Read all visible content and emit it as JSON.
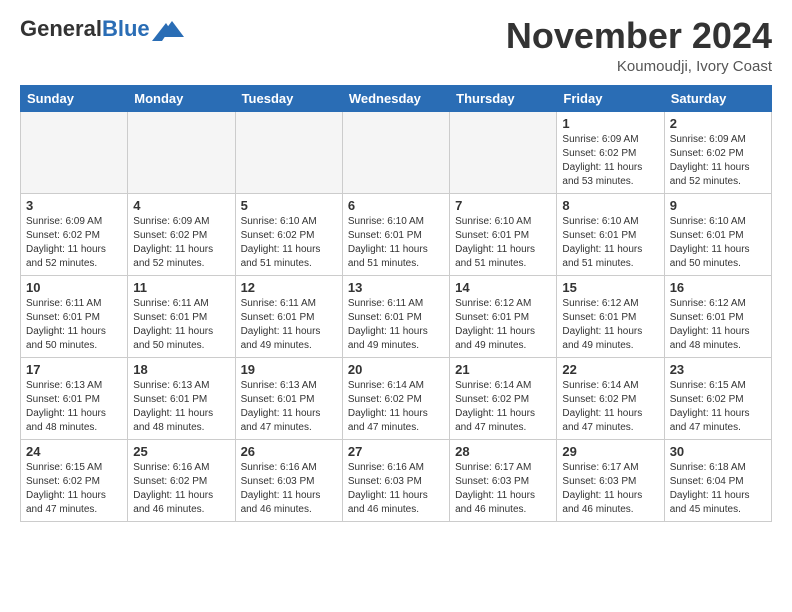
{
  "header": {
    "logo_general": "General",
    "logo_blue": "Blue",
    "month_title": "November 2024",
    "location": "Koumoudji, Ivory Coast"
  },
  "weekdays": [
    "Sunday",
    "Monday",
    "Tuesday",
    "Wednesday",
    "Thursday",
    "Friday",
    "Saturday"
  ],
  "weeks": [
    [
      {
        "day": "",
        "empty": true
      },
      {
        "day": "",
        "empty": true
      },
      {
        "day": "",
        "empty": true
      },
      {
        "day": "",
        "empty": true
      },
      {
        "day": "",
        "empty": true
      },
      {
        "day": "1",
        "sunrise": "6:09 AM",
        "sunset": "6:02 PM",
        "daylight": "11 hours and 53 minutes."
      },
      {
        "day": "2",
        "sunrise": "6:09 AM",
        "sunset": "6:02 PM",
        "daylight": "11 hours and 52 minutes."
      }
    ],
    [
      {
        "day": "3",
        "sunrise": "6:09 AM",
        "sunset": "6:02 PM",
        "daylight": "11 hours and 52 minutes."
      },
      {
        "day": "4",
        "sunrise": "6:09 AM",
        "sunset": "6:02 PM",
        "daylight": "11 hours and 52 minutes."
      },
      {
        "day": "5",
        "sunrise": "6:10 AM",
        "sunset": "6:02 PM",
        "daylight": "11 hours and 51 minutes."
      },
      {
        "day": "6",
        "sunrise": "6:10 AM",
        "sunset": "6:01 PM",
        "daylight": "11 hours and 51 minutes."
      },
      {
        "day": "7",
        "sunrise": "6:10 AM",
        "sunset": "6:01 PM",
        "daylight": "11 hours and 51 minutes."
      },
      {
        "day": "8",
        "sunrise": "6:10 AM",
        "sunset": "6:01 PM",
        "daylight": "11 hours and 51 minutes."
      },
      {
        "day": "9",
        "sunrise": "6:10 AM",
        "sunset": "6:01 PM",
        "daylight": "11 hours and 50 minutes."
      }
    ],
    [
      {
        "day": "10",
        "sunrise": "6:11 AM",
        "sunset": "6:01 PM",
        "daylight": "11 hours and 50 minutes."
      },
      {
        "day": "11",
        "sunrise": "6:11 AM",
        "sunset": "6:01 PM",
        "daylight": "11 hours and 50 minutes."
      },
      {
        "day": "12",
        "sunrise": "6:11 AM",
        "sunset": "6:01 PM",
        "daylight": "11 hours and 49 minutes."
      },
      {
        "day": "13",
        "sunrise": "6:11 AM",
        "sunset": "6:01 PM",
        "daylight": "11 hours and 49 minutes."
      },
      {
        "day": "14",
        "sunrise": "6:12 AM",
        "sunset": "6:01 PM",
        "daylight": "11 hours and 49 minutes."
      },
      {
        "day": "15",
        "sunrise": "6:12 AM",
        "sunset": "6:01 PM",
        "daylight": "11 hours and 49 minutes."
      },
      {
        "day": "16",
        "sunrise": "6:12 AM",
        "sunset": "6:01 PM",
        "daylight": "11 hours and 48 minutes."
      }
    ],
    [
      {
        "day": "17",
        "sunrise": "6:13 AM",
        "sunset": "6:01 PM",
        "daylight": "11 hours and 48 minutes."
      },
      {
        "day": "18",
        "sunrise": "6:13 AM",
        "sunset": "6:01 PM",
        "daylight": "11 hours and 48 minutes."
      },
      {
        "day": "19",
        "sunrise": "6:13 AM",
        "sunset": "6:01 PM",
        "daylight": "11 hours and 47 minutes."
      },
      {
        "day": "20",
        "sunrise": "6:14 AM",
        "sunset": "6:02 PM",
        "daylight": "11 hours and 47 minutes."
      },
      {
        "day": "21",
        "sunrise": "6:14 AM",
        "sunset": "6:02 PM",
        "daylight": "11 hours and 47 minutes."
      },
      {
        "day": "22",
        "sunrise": "6:14 AM",
        "sunset": "6:02 PM",
        "daylight": "11 hours and 47 minutes."
      },
      {
        "day": "23",
        "sunrise": "6:15 AM",
        "sunset": "6:02 PM",
        "daylight": "11 hours and 47 minutes."
      }
    ],
    [
      {
        "day": "24",
        "sunrise": "6:15 AM",
        "sunset": "6:02 PM",
        "daylight": "11 hours and 47 minutes."
      },
      {
        "day": "25",
        "sunrise": "6:16 AM",
        "sunset": "6:02 PM",
        "daylight": "11 hours and 46 minutes."
      },
      {
        "day": "26",
        "sunrise": "6:16 AM",
        "sunset": "6:03 PM",
        "daylight": "11 hours and 46 minutes."
      },
      {
        "day": "27",
        "sunrise": "6:16 AM",
        "sunset": "6:03 PM",
        "daylight": "11 hours and 46 minutes."
      },
      {
        "day": "28",
        "sunrise": "6:17 AM",
        "sunset": "6:03 PM",
        "daylight": "11 hours and 46 minutes."
      },
      {
        "day": "29",
        "sunrise": "6:17 AM",
        "sunset": "6:03 PM",
        "daylight": "11 hours and 46 minutes."
      },
      {
        "day": "30",
        "sunrise": "6:18 AM",
        "sunset": "6:04 PM",
        "daylight": "11 hours and 45 minutes."
      }
    ]
  ]
}
